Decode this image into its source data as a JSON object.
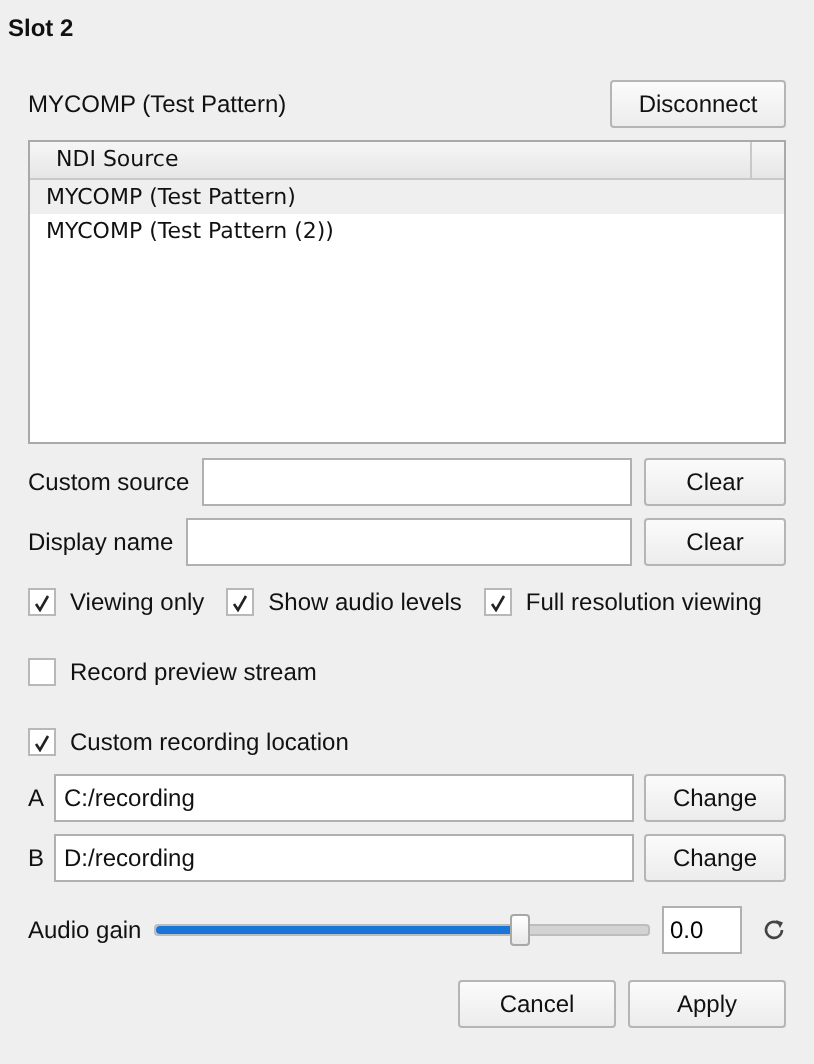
{
  "title": "Slot 2",
  "source": {
    "name": "MYCOMP (Test Pattern)",
    "button": "Disconnect"
  },
  "table": {
    "columns": [
      "NDI Source"
    ],
    "rows": [
      {
        "label": "MYCOMP (Test Pattern)",
        "selected": true
      },
      {
        "label": "MYCOMP (Test Pattern (2))",
        "selected": false
      }
    ]
  },
  "fields": [
    {
      "label": "Custom source",
      "button": "Clear"
    },
    {
      "label": "Display name",
      "button": "Clear"
    }
  ],
  "options_row": [
    {
      "label": "Viewing only",
      "checked": true
    },
    {
      "label": "Show audio levels",
      "checked": true
    },
    {
      "label": "Full resolution viewing",
      "checked": true
    }
  ],
  "options": [
    {
      "label": "Record preview stream",
      "checked": false
    },
    {
      "label": "Custom recording location",
      "checked": true
    }
  ],
  "locations": [
    {
      "label": "A",
      "value": "C:/recording",
      "button": "Change"
    },
    {
      "label": "B",
      "value": "D:/recording",
      "button": "Change"
    }
  ],
  "audio_gain": {
    "label": "Audio gain",
    "level": 0.74,
    "value": "0.0"
  },
  "buttons": [
    "Cancel",
    "Apply"
  ]
}
